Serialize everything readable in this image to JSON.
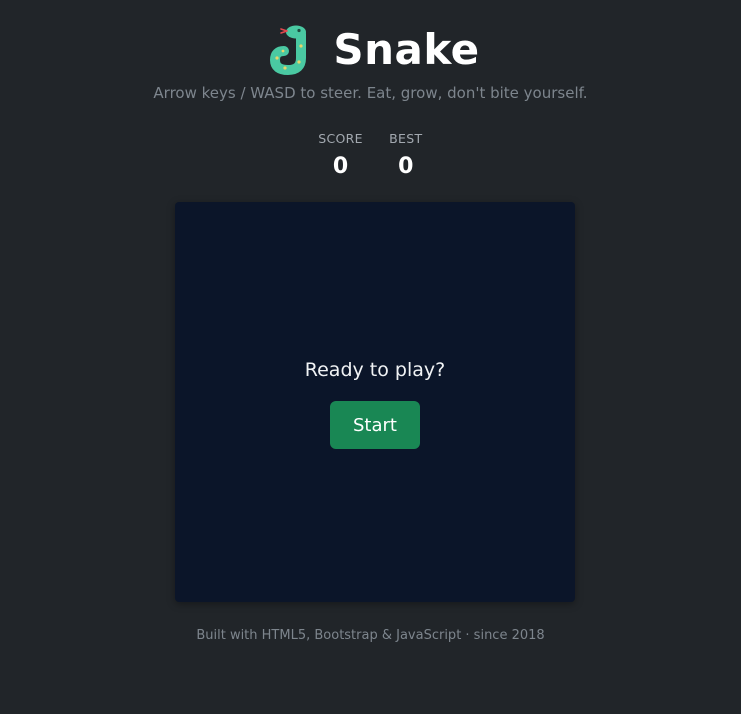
{
  "app": {
    "title": "Snake",
    "subtitle": "Arrow keys / WASD to steer. Eat, grow, don't bite yourself.",
    "logo_icon": "snake-icon"
  },
  "scoreboard": {
    "score_label": "SCORE",
    "score_value": "0",
    "best_label": "BEST",
    "best_value": "0"
  },
  "board": {
    "ready_text": "Ready to play?",
    "start_label": "Start"
  },
  "footer": {
    "text": "Built with HTML5, Bootstrap & JavaScript · since 2018"
  },
  "colors": {
    "page_bg": "#212529",
    "board_bg": "#0b1529",
    "accent_green": "#198754",
    "snake_teal": "#4ac9a2"
  }
}
